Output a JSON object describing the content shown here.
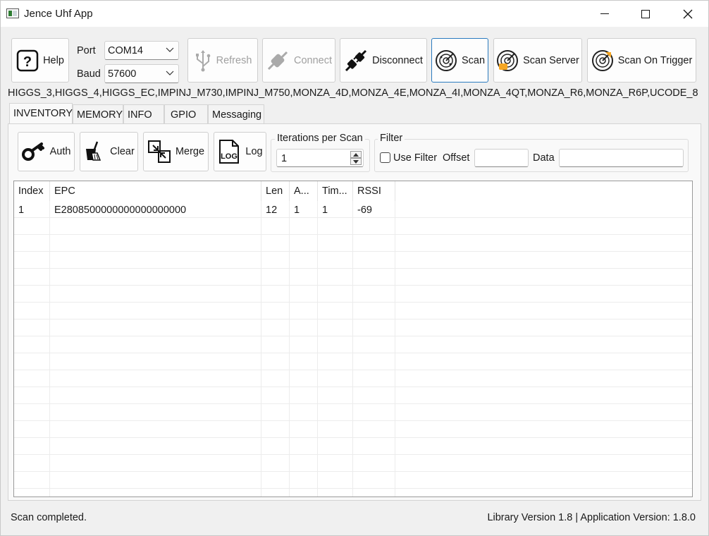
{
  "window": {
    "title": "Jence Uhf App"
  },
  "toolbar": {
    "help": "Help",
    "port_label": "Port",
    "port_value": "COM14",
    "baud_label": "Baud",
    "baud_value": "57600",
    "refresh": "Refresh",
    "connect": "Connect",
    "disconnect": "Disconnect",
    "scan": "Scan",
    "scan_server": "Scan Server",
    "scan_on_trigger": "Scan On Trigger"
  },
  "chip_types": "HIGGS_3,HIGGS_4,HIGGS_EC,IMPINJ_M730,IMPINJ_M750,MONZA_4D,MONZA_4E,MONZA_4I,MONZA_4QT,MONZA_R6,MONZA_R6P,UCODE_8",
  "tabs": [
    "INVENTORY",
    "MEMORY",
    "INFO",
    "GPIO",
    "Messaging"
  ],
  "actions": {
    "auth": "Auth",
    "clear": "Clear",
    "merge": "Merge",
    "log": "Log",
    "log_icon_text": "LOG"
  },
  "iterations": {
    "label": "Iterations per Scan",
    "value": "1"
  },
  "filter": {
    "title": "Filter",
    "use_filter": "Use Filter",
    "use_filter_checked": false,
    "offset_label": "Offset",
    "offset_value": "",
    "data_label": "Data",
    "data_value": ""
  },
  "table": {
    "columns": [
      "Index",
      "EPC",
      "Len",
      "A...",
      "Tim...",
      "RSSI"
    ],
    "rows": [
      {
        "index": "1",
        "epc": "E2808500000000000000000",
        "len": "12",
        "a": "1",
        "tim": "1",
        "rssi": "-69"
      }
    ]
  },
  "status": {
    "message": "Scan completed.",
    "version": "Library Version 1.8 | Application Version: 1.8.0"
  }
}
